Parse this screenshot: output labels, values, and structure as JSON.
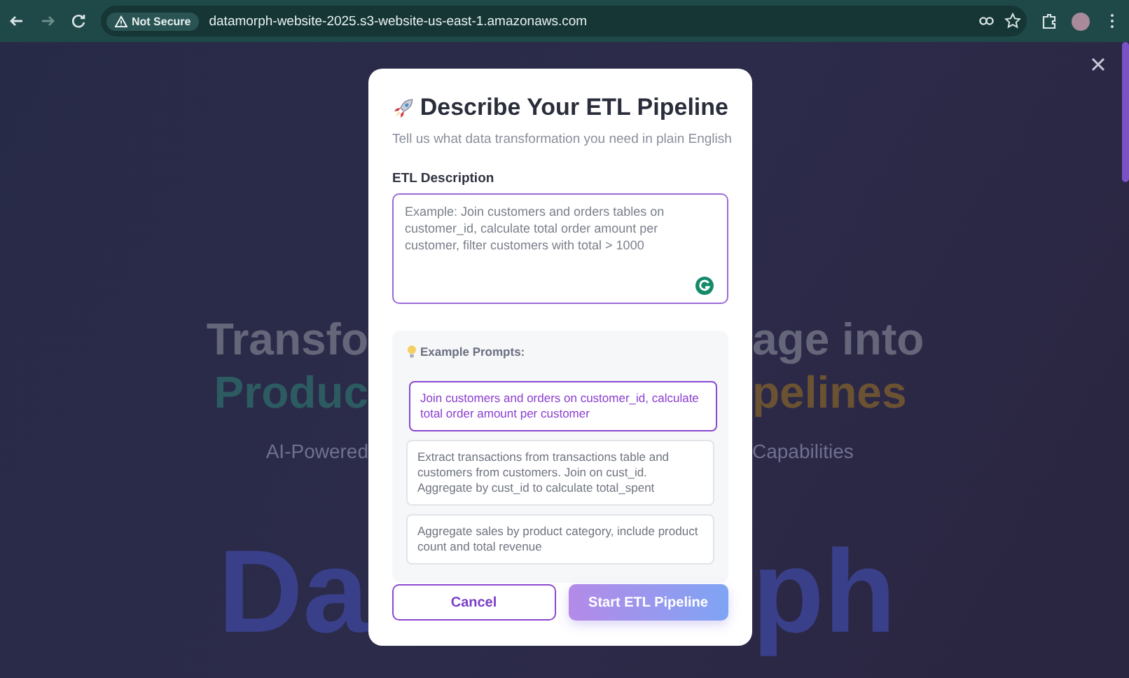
{
  "browser": {
    "security_label": "Not Secure",
    "url": "datamorph-website-2025.s3-website-us-east-1.amazonaws.com",
    "forward_disabled": true
  },
  "background": {
    "rows": [
      {
        "kind": "headline",
        "left": "Transfo",
        "right": "age into"
      },
      {
        "kind": "accent",
        "left": "Produc",
        "right": "pelines"
      },
      {
        "kind": "subtitle",
        "left": "AI-Powered",
        "right": "Capabilities"
      },
      {
        "kind": "logo",
        "left": "Da",
        "right": "ph"
      }
    ]
  },
  "modal": {
    "title": "Describe Your ETL Pipeline",
    "subtitle": "Tell us what data transformation you need in plain English",
    "field_label": "ETL Description",
    "placeholder": "Example: Join customers and orders tables on customer_id, calculate total order amount per customer, filter customers with total > 1000",
    "prompts_heading": "Example Prompts:",
    "prompts": [
      {
        "text": "Join customers and orders on customer_id, calculate total order amount per customer",
        "selected": true
      },
      {
        "text": "Extract transactions from transactions table and customers from customers. Join on cust_id. Aggregate by cust_id to calculate total_spent",
        "selected": false
      },
      {
        "text": "Aggregate sales by product category, include product count and total revenue",
        "selected": false
      }
    ],
    "cancel": "Cancel",
    "submit": "Start ETL Pipeline"
  }
}
